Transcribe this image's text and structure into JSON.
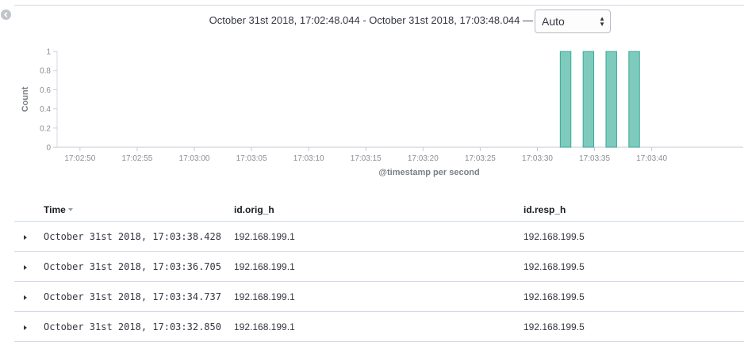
{
  "header": {
    "time_range": "October 31st 2018, 17:02:48.044 - October 31st 2018, 17:03:48.044 —",
    "interval": {
      "selected": "Auto",
      "arrows": "▲\n▼"
    }
  },
  "chart_data": {
    "type": "bar",
    "ylabel": "Count",
    "xlabel": "@timestamp per second",
    "ylim": [
      0,
      1
    ],
    "y_ticks": [
      "0",
      "0.2",
      "0.4",
      "0.6",
      "0.8",
      "1"
    ],
    "x_ticks": [
      "17:02:50",
      "17:02:55",
      "17:03:00",
      "17:03:05",
      "17:03:10",
      "17:03:15",
      "17:03:20",
      "17:03:25",
      "17:03:30",
      "17:03:35",
      "17:03:40"
    ],
    "x_range": [
      "17:02:48",
      "17:03:48"
    ],
    "bar_width_seconds": 1,
    "points": [
      {
        "x": "17:03:32",
        "y": 1
      },
      {
        "x": "17:03:34",
        "y": 1
      },
      {
        "x": "17:03:36",
        "y": 1
      },
      {
        "x": "17:03:38",
        "y": 1
      }
    ],
    "bar_color": "#7ecbbe",
    "bar_stroke": "#3aa897",
    "grid": false,
    "legend": "none"
  },
  "table": {
    "columns": {
      "time": "Time",
      "orig": "id.orig_h",
      "resp": "id.resp_h"
    },
    "rows": [
      {
        "time": "October 31st 2018, 17:03:38.428",
        "orig": "192.168.199.1",
        "resp": "192.168.199.5"
      },
      {
        "time": "October 31st 2018, 17:03:36.705",
        "orig": "192.168.199.1",
        "resp": "192.168.199.5"
      },
      {
        "time": "October 31st 2018, 17:03:34.737",
        "orig": "192.168.199.1",
        "resp": "192.168.199.5"
      },
      {
        "time": "October 31st 2018, 17:03:32.850",
        "orig": "192.168.199.1",
        "resp": "192.168.199.5"
      }
    ]
  }
}
